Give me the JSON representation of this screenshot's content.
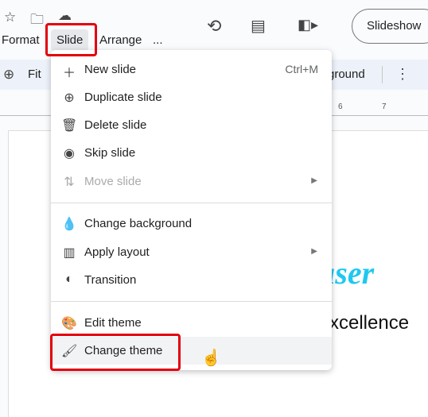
{
  "header": {
    "menus": [
      "Format",
      "Slide",
      "Arrange",
      "..."
    ],
    "slideshow_label": "Slideshow"
  },
  "toolbar": {
    "zoom_label": "Fit",
    "background_partial": "ground"
  },
  "ruler": {
    "ticks": [
      "6",
      "7"
    ]
  },
  "slide": {
    "title_partial": "user",
    "subtitle_partial": "xcellence",
    "title_color": "#1ec8f0"
  },
  "slide_menu": {
    "items": [
      {
        "icon": "plus-icon",
        "label": "New slide",
        "shortcut": "Ctrl+M"
      },
      {
        "icon": "duplicate-icon",
        "label": "Duplicate slide"
      },
      {
        "icon": "trash-icon",
        "label": "Delete slide"
      },
      {
        "icon": "eye-icon",
        "label": "Skip slide"
      },
      {
        "icon": "move-icon",
        "label": "Move slide",
        "disabled": true,
        "submenu": true
      },
      {
        "icon": "droplet-icon",
        "label": "Change background"
      },
      {
        "icon": "layout-icon",
        "label": "Apply layout",
        "submenu": true
      },
      {
        "icon": "transition-icon",
        "label": "Transition"
      },
      {
        "icon": "palette-icon",
        "label": "Edit theme"
      },
      {
        "icon": "paint-roller-icon",
        "label": "Change theme",
        "hovered": true
      }
    ]
  },
  "highlight_color": "#e3000f"
}
